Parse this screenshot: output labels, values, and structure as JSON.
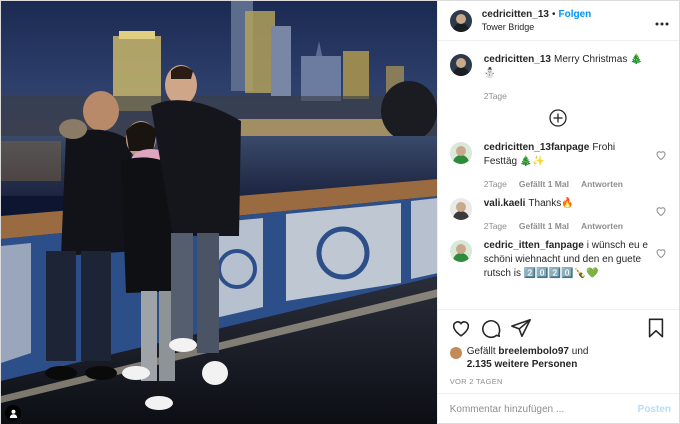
{
  "header": {
    "username": "cedricitten_13",
    "separator": "•",
    "follow_label": "Folgen",
    "location": "Tower Bridge",
    "more_icon": "more-horizontal-icon"
  },
  "caption": {
    "username": "cedricitten_13",
    "text": "Merry Christmas 🎄⛄",
    "time": "2Tage"
  },
  "comments": [
    {
      "username": "cedricitten_13fanpage",
      "text": "Frohi Festtäg 🎄✨",
      "time": "2Tage",
      "likes": "Gefällt 1 Mal",
      "reply": "Antworten"
    },
    {
      "username": "vali.kaeli",
      "text": "Thanks🔥",
      "time": "2Tage",
      "likes": "Gefällt 1 Mal",
      "reply": "Antworten"
    },
    {
      "username": "cedric_itten_fanpage",
      "text": "i wünsch eu e schöni wiehnacht und den en guete rutsch is 2️⃣0️⃣2️⃣0️⃣🍾💚",
      "time": "",
      "likes": "",
      "reply": ""
    }
  ],
  "likes": {
    "prefix": "Gefällt",
    "user": "breelembolo97",
    "conjunction": "und",
    "others": "2.135 weitere Personen"
  },
  "timestamp": "VOR 2 TAGEN",
  "comment_box": {
    "placeholder": "Kommentar hinzufügen ...",
    "post_label": "Posten"
  },
  "colors": {
    "accent": "#0095f6",
    "muted": "#8e8e8e",
    "post_disabled": "#b2dffc"
  }
}
